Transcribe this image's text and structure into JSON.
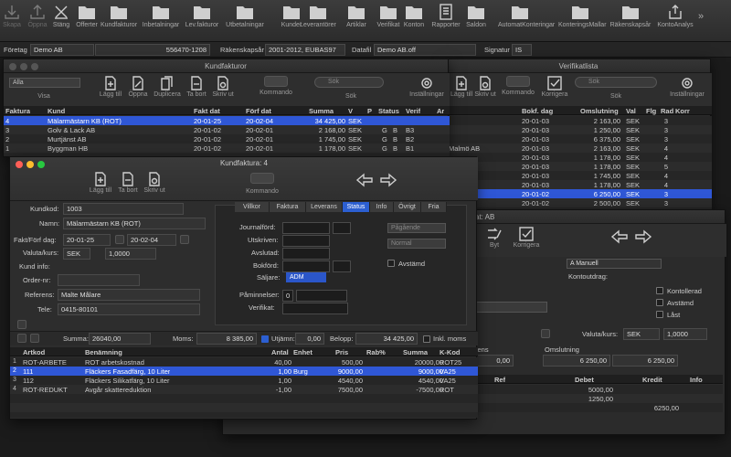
{
  "toolbar": {
    "items": [
      {
        "label": "Skapa",
        "icon": "download-icon",
        "x": 0
      },
      {
        "label": "Öppna",
        "icon": "upload-icon",
        "x": 1
      },
      {
        "label": "Stäng",
        "icon": "close-icon",
        "x": 2
      },
      {
        "label": "Offerter",
        "icon": "folder-icon",
        "x": 3
      },
      {
        "label": "Kundfakturor",
        "icon": "folder-icon",
        "x": 4
      },
      {
        "label": "Inbetalningar",
        "icon": "folder-icon",
        "x": 5
      },
      {
        "label": "Lev.fakturor",
        "icon": "folder-icon",
        "x": 6
      },
      {
        "label": "Utbetalningar",
        "icon": "folder-icon",
        "x": 7
      },
      {
        "label": "Kunder",
        "icon": "folder-icon",
        "x": 8
      },
      {
        "label": "Leverantörer",
        "icon": "folder-icon",
        "x": 9
      },
      {
        "label": "Artiklar",
        "icon": "folder-icon",
        "x": 10
      },
      {
        "label": "Verifikat",
        "icon": "folder-icon",
        "x": 11
      },
      {
        "label": "Konton",
        "icon": "folder-icon",
        "x": 12
      },
      {
        "label": "Rapporter",
        "icon": "report-icon",
        "x": 13
      },
      {
        "label": "Saldon",
        "icon": "folder-icon",
        "x": 14
      },
      {
        "label": "AutomatKonteringar",
        "icon": "folder-icon",
        "x": 15
      },
      {
        "label": "KonteringsMallar",
        "icon": "folder-icon",
        "x": 16
      },
      {
        "label": "Räkenskapsår",
        "icon": "folder-icon",
        "x": 17
      },
      {
        "label": "KontoAnalys",
        "icon": "share-icon",
        "x": 18
      }
    ],
    "more": "»"
  },
  "infobar": {
    "foretag_label": "Företag",
    "foretag": "Demo AB",
    "orgnr": "556470-1208",
    "rakenskapsar_label": "Räkenskapsår",
    "rakenskapsar": "2001-2012, EUBAS97",
    "datafil_label": "Datafil",
    "datafil": "Demo AB.off",
    "signatur_label": "Signatur",
    "signatur": "IS"
  },
  "kundfakturor": {
    "title": "Kundfakturor",
    "filter": "Alla",
    "visa": "Visa",
    "buttons": [
      "Lägg till",
      "Öppna",
      "Duplicera",
      "Ta bort",
      "Skriv ut",
      "Kommando",
      "Sök",
      "Inställningar"
    ],
    "search_placeholder": "Sök",
    "columns": [
      "Faktura",
      "Kund",
      "Fakt dat",
      "Förf dat",
      "Summa",
      "V",
      "P",
      "Status",
      "Verif",
      "Ar"
    ],
    "rows": [
      [
        "4",
        "Mälarmästarn KB (ROT)",
        "20-01-25",
        "20-02-04",
        "34 425,00",
        "SEK",
        "",
        "",
        "",
        ""
      ],
      [
        "3",
        "Golv & Lack AB",
        "20-01-02",
        "20-02-01",
        "2 168,00",
        "SEK",
        "",
        "G",
        "B",
        "B3"
      ],
      [
        "2",
        "Murtjänst AB",
        "20-01-02",
        "20-02-01",
        "1 745,00",
        "SEK",
        "",
        "G",
        "B",
        "B2"
      ],
      [
        "1",
        "Byggman HB",
        "20-01-02",
        "20-02-01",
        "1 178,00",
        "SEK",
        "",
        "G",
        "B",
        "B1"
      ]
    ]
  },
  "verifikatlista": {
    "title": "Verifikatlista",
    "buttons": [
      "Lägg till",
      "Skriv ut",
      "Kommando",
      "Korrigera",
      "Sök",
      "Inställningar"
    ],
    "search_placeholder": "Sök",
    "columns": [
      "Bokf. dag",
      "Omslutning",
      "Val",
      "Flg",
      "Rad",
      "Korr"
    ],
    "rows": [
      [
        "",
        "20-01-03",
        "2 163,00",
        "SEK",
        "",
        "3",
        ""
      ],
      [
        "",
        "20-01-03",
        "1 250,00",
        "SEK",
        "",
        "3",
        ""
      ],
      [
        "",
        "20-01-03",
        "6 375,00",
        "SEK",
        "",
        "3",
        ""
      ],
      [
        "Malmö AB",
        "20-01-03",
        "2 163,00",
        "SEK",
        "",
        "4",
        ""
      ],
      [
        "",
        "20-01-03",
        "1 178,00",
        "SEK",
        "",
        "4",
        ""
      ],
      [
        "",
        "20-01-03",
        "1 178,00",
        "SEK",
        "",
        "5",
        ""
      ],
      [
        "",
        "20-01-03",
        "1 745,00",
        "SEK",
        "",
        "4",
        ""
      ],
      [
        "",
        "20-01-03",
        "1 178,00",
        "SEK",
        "",
        "4",
        ""
      ],
      [
        "",
        "20-01-02",
        "6 250,00",
        "SEK",
        "",
        "3",
        ""
      ],
      [
        "",
        "20-01-02",
        "2 500,00",
        "SEK",
        "",
        "3",
        ""
      ]
    ]
  },
  "verifikat": {
    "title_suffix": "at: AB",
    "buttons": [
      "Byt",
      "Korrigera"
    ],
    "manuell": "A Manuell",
    "kontoutdrag": "Kontoutdrag:",
    "checks": [
      "Kontollerad",
      "Avstämd",
      "Låst"
    ],
    "valuta_label": "Valuta/kurs:",
    "valuta": "SEK",
    "kurs": "1,0000",
    "rens_label": "rens",
    "omslutning_label": "Omslutning",
    "diff": "0,00",
    "oms1": "6 250,00",
    "oms2": "6 250,00",
    "columns": [
      "Ref",
      "Debet",
      "Kredit",
      "Info"
    ],
    "rows": [
      [
        "",
        "5000,00",
        "",
        ""
      ],
      [
        "",
        "1250,00",
        "",
        ""
      ],
      [
        "",
        "",
        "6250,00",
        ""
      ]
    ]
  },
  "kundfaktura": {
    "title": "Kundfaktura: 4",
    "buttons": [
      "Lägg till",
      "Ta bort",
      "Skriv ut",
      "Kommando"
    ],
    "kundkod_label": "Kundkod:",
    "kundkod": "1003",
    "namn_label": "Namn:",
    "namn": "Mälarmästarn KB (ROT)",
    "faktdag_label": "Fakt/Förf dag:",
    "faktdat": "20-01-25",
    "forfdat": "20-02-04",
    "valuta_label": "Valuta/kurs:",
    "valuta": "SEK",
    "kurs": "1,0000",
    "kundinfo_label": "Kund info:",
    "ordernr_label": "Order-nr:",
    "ordernr": "",
    "referens_label": "Referens:",
    "referens": "Malte Målare",
    "tele_label": "Tele:",
    "tele": "0415-80101",
    "tabs": [
      "Villkor",
      "Faktura",
      "Leverans",
      "Status",
      "Info",
      "Övrigt",
      "Fria"
    ],
    "active_tab": "Status",
    "status": {
      "journalford": "Journalförd:",
      "utskriven": "Utskriven:",
      "avslutad": "Avslutad:",
      "bokford": "Bokförd:",
      "saljare_label": "Säljare:",
      "saljare": "ADM",
      "paminnelser_label": "Påminnelser:",
      "paminnelser": "0",
      "verifikat_label": "Verifikat:",
      "pagaende": "Pågående",
      "normal": "Normal",
      "avstamd": "Avstämd"
    },
    "summa_label": "Summa:",
    "summa": "26040,00",
    "moms_label": "Moms:",
    "moms": "8 385,00",
    "utjamn_label": "Utjämn:",
    "utjamn": "0,00",
    "belopp_label": "Belopp:",
    "belopp": "34 425,00",
    "inkl_moms": "Inkl. moms",
    "columns": [
      "Artkod",
      "Benämning",
      "Antal",
      "Enhet",
      "Pris",
      "Rab%",
      "Summa",
      "K-Kod"
    ],
    "rows": [
      [
        "ROT-ARBETE",
        "ROT arbetskostnad",
        "40,00",
        "",
        "500,00",
        "",
        "20000,00",
        "ROT25"
      ],
      [
        "111",
        "Fläckers Fasadfärg, 10 Liter",
        "1,00",
        "Burg",
        "9000,00",
        "",
        "9000,00",
        "VA25"
      ],
      [
        "112",
        "Fläckers Silikatfärg, 10 Liter",
        "1,00",
        "",
        "4540,00",
        "",
        "4540,00",
        "VA25"
      ],
      [
        "ROT-REDUKT",
        "Avgår skattereduktion",
        "-1,00",
        "",
        "7500,00",
        "",
        "-7500,00",
        "ROT"
      ]
    ]
  }
}
